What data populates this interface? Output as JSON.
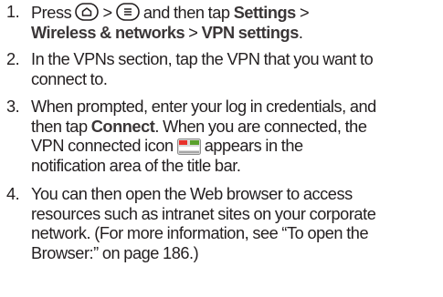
{
  "steps": [
    {
      "number": "1.",
      "press": "Press",
      "gt1": ">",
      "and_then_tap": "and then tap",
      "settings": "Settings",
      "gt2": ">",
      "wireless": "Wireless & networks",
      "gt3": ">",
      "vpn_settings": "VPN settings",
      "period": ".",
      "icons": [
        "home-key-icon",
        "menu-key-icon"
      ]
    },
    {
      "number": "2.",
      "line1": "In the VPNs section, tap the VPN that you want to",
      "line2": "connect to."
    },
    {
      "number": "3.",
      "line1": "When prompted, enter your log in credentials, and",
      "then_tap": "then tap",
      "connect": "Connect",
      "line2_rest": ". When you are connected, the",
      "line3_pre": "VPN connected icon",
      "line3_post": "appears in the",
      "line4": "notification area of the title bar.",
      "icon": "vpn-connected-icon"
    },
    {
      "number": "4.",
      "line1": "You can then open the Web browser to access",
      "line2": "resources such as intranet sites on your corporate",
      "line3": "network. (For more information, see “To open the",
      "line4": "Browser:” on page 186.)"
    }
  ],
  "colors": {
    "text": "#231f20",
    "vpn_icon_red": "#e8312b",
    "vpn_icon_green": "#5aa02c"
  }
}
